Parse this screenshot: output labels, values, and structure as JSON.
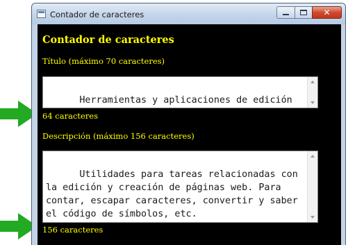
{
  "window": {
    "title": "Contador de caracteres"
  },
  "content": {
    "heading": "Contador de caracteres",
    "title_field": {
      "label": "Título (máximo 70 caracteres)",
      "value": "Herramientas y aplicaciones de edición web para descargar gratis",
      "counter": "64 caracteres"
    },
    "description_field": {
      "label": "Descripción (máximo 156 caracteres)",
      "value": "Utilidades para tareas relacionadas con la edición y creación de páginas web. Para contar, escapar caracteres, convertir y saber el código de símbolos, etc.",
      "counter": "156 caracteres"
    }
  },
  "colors": {
    "content_background": "#000000",
    "label_text": "#ffff00",
    "arrow": "#22aa22",
    "close_button": "#c1361b"
  },
  "icons": [
    "app-icon",
    "minimize-icon",
    "maximize-icon",
    "close-icon",
    "arrow-right-icon"
  ]
}
